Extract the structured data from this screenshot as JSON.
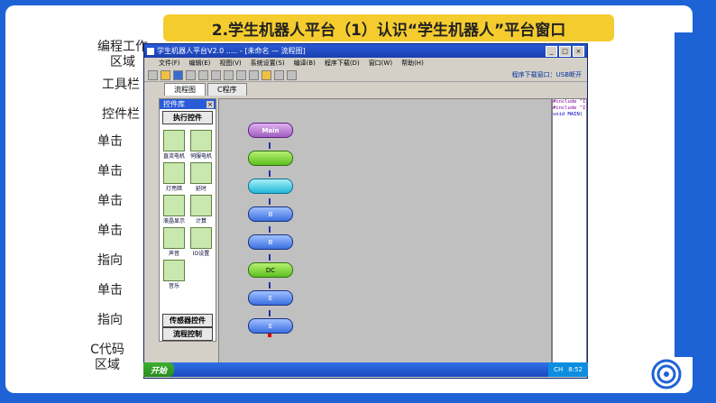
{
  "slide": {
    "title": "2.学生机器人平台（1）认识“学生机器人”平台窗口",
    "labels": [
      "编程工作区域",
      "工具栏",
      "控件栏",
      "单击",
      "单击",
      "单击",
      "单击",
      "指向",
      "单击",
      "指向",
      "C代码区域"
    ]
  },
  "window": {
    "title": "学生机器人平台V2.0 ..... - [未命名 — 流程图]",
    "menu": [
      "文件(F)",
      "编辑(E)",
      "视图(V)",
      "系统设置(S)",
      "编译(B)",
      "程序下载(D)",
      "窗口(W)",
      "帮助(H)"
    ],
    "status_right": "程序下载窗口：USB断开",
    "tabs": [
      "流程图",
      "C程序"
    ]
  },
  "palette": {
    "header": "控件库",
    "exec_button": "执行控件",
    "items": [
      {
        "label": "直流电机",
        "icon": "dc-motor-icon"
      },
      {
        "label": "伺服电机",
        "icon": "servo-motor-icon"
      },
      {
        "label": "灯亮暗",
        "icon": "light-icon"
      },
      {
        "label": "延时",
        "icon": "delay-icon"
      },
      {
        "label": "液晶显示",
        "icon": "lcd-icon"
      },
      {
        "label": "计算",
        "icon": "calculator-icon"
      },
      {
        "label": "声音",
        "icon": "sound-icon"
      },
      {
        "label": "IO设置",
        "icon": "io-icon"
      },
      {
        "label": "音乐",
        "icon": "music-icon"
      }
    ],
    "sensor_button": "传感器控件",
    "flow_button": "流程控制"
  },
  "flowchart": {
    "blocks": [
      {
        "label": "Main",
        "style": "main"
      },
      {
        "label": "",
        "style": "green"
      },
      {
        "label": "",
        "style": "cyan"
      },
      {
        "label": "B",
        "style": "blue"
      },
      {
        "label": "B",
        "style": "blue"
      },
      {
        "label": "DC",
        "style": "green"
      },
      {
        "label": "E",
        "style": "blue"
      },
      {
        "label": "E",
        "style": "blue"
      }
    ]
  },
  "code_area": {
    "lines": [
      "#include \"I",
      "#include \"I",
      "void MAIN("
    ]
  },
  "taskbar": {
    "start": "开始",
    "clock": "8:52",
    "ime": "CH"
  }
}
